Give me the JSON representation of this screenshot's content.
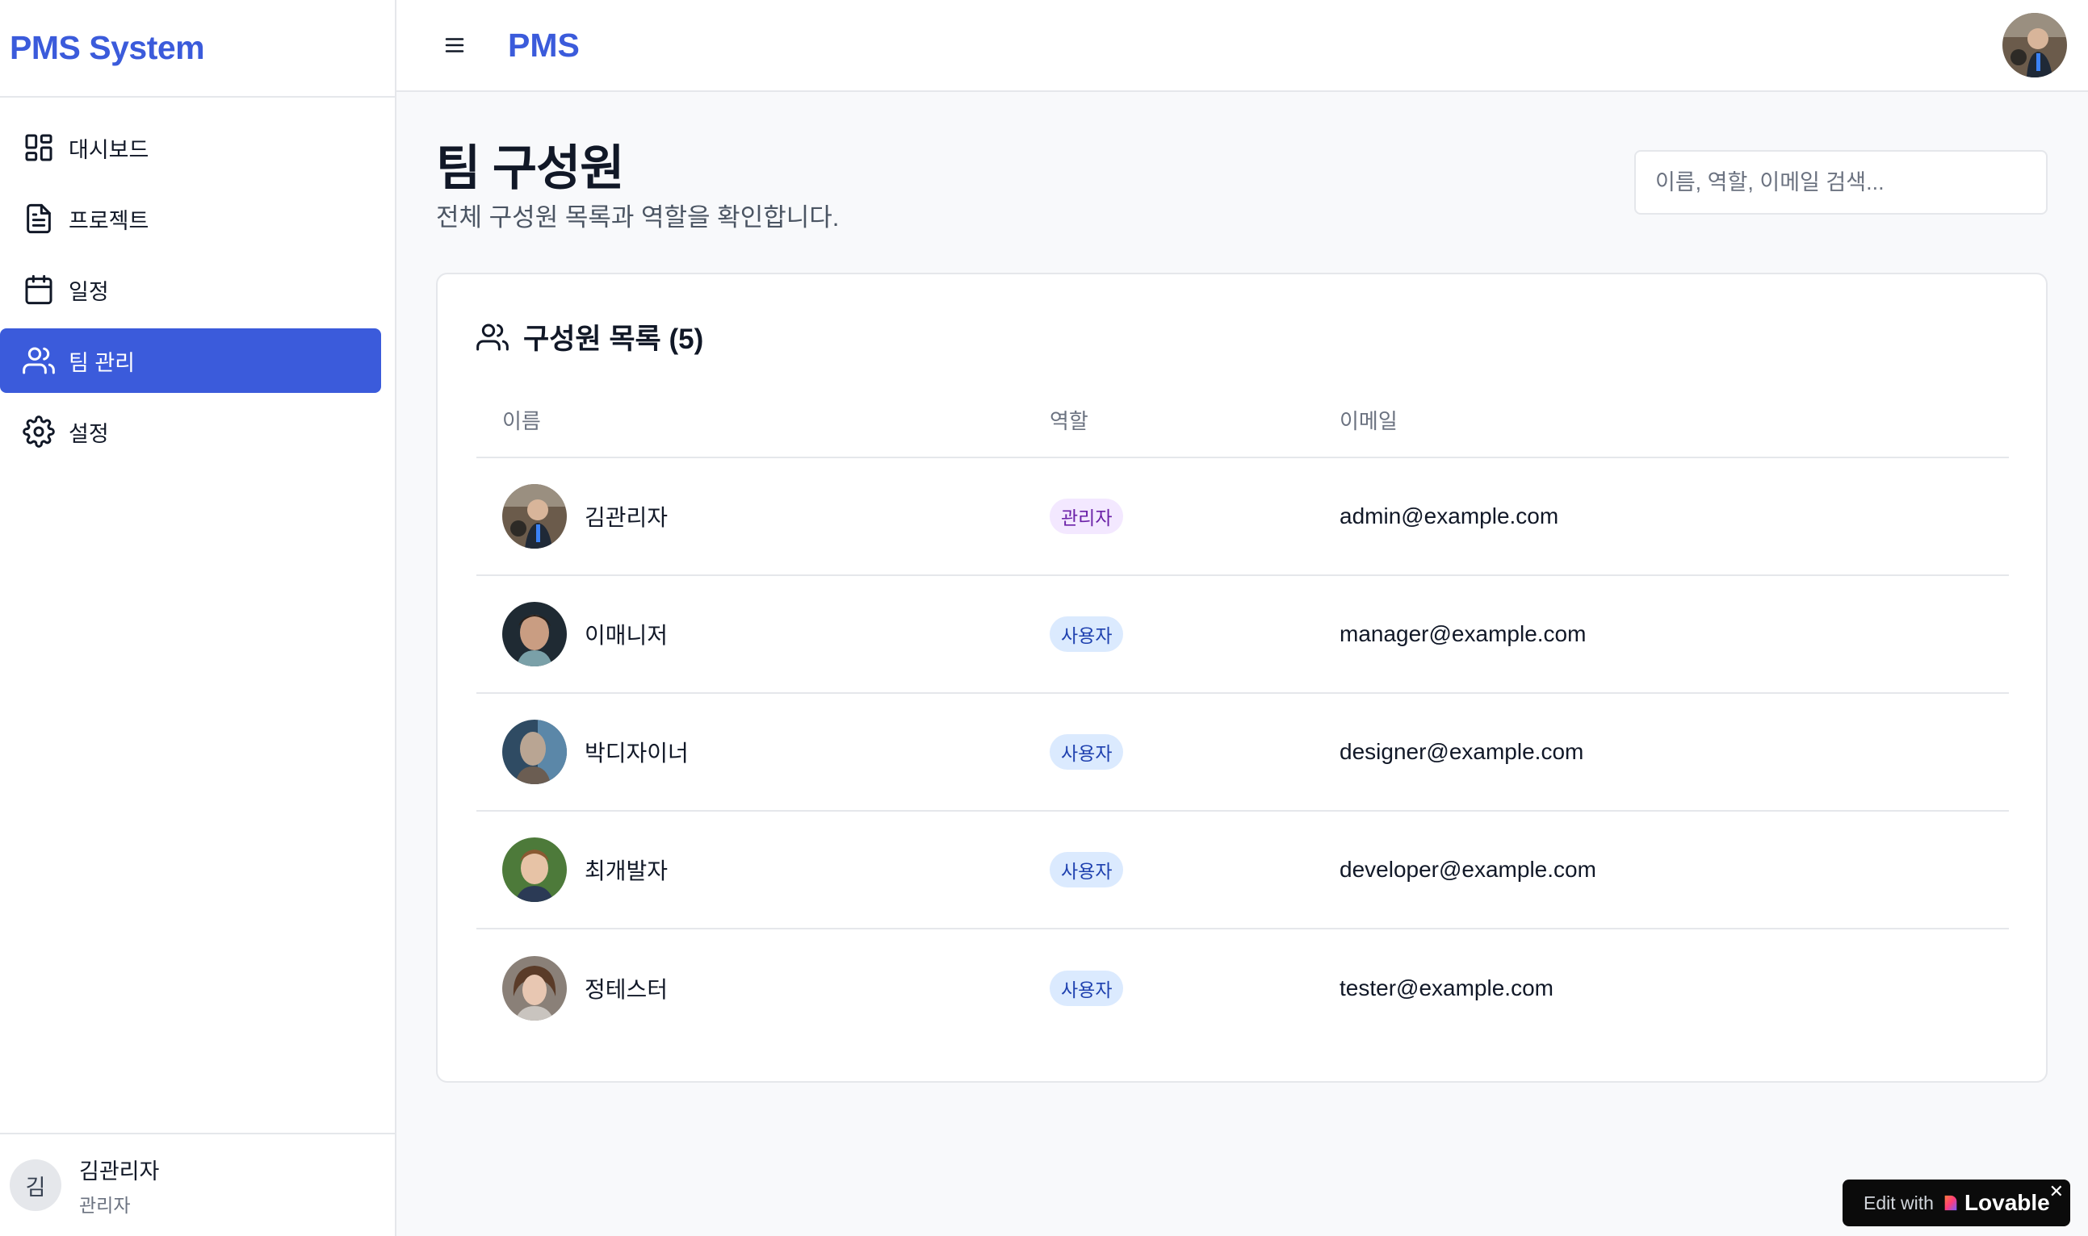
{
  "sidebar": {
    "brand": "PMS System",
    "items": [
      {
        "label": "대시보드",
        "icon": "dashboard-icon"
      },
      {
        "label": "프로젝트",
        "icon": "document-icon"
      },
      {
        "label": "일정",
        "icon": "calendar-icon"
      },
      {
        "label": "팀 관리",
        "icon": "users-icon",
        "active": true
      },
      {
        "label": "설정",
        "icon": "gear-icon"
      }
    ],
    "user": {
      "initial": "김",
      "name": "김관리자",
      "role": "관리자"
    }
  },
  "header": {
    "title": "PMS"
  },
  "page": {
    "title": "팀 구성원",
    "subtitle": "전체 구성원 목록과 역할을 확인합니다.",
    "search_placeholder": "이름, 역할, 이메일 검색..."
  },
  "members_card": {
    "title": "구성원 목록 (5)",
    "columns": {
      "name": "이름",
      "role": "역할",
      "email": "이메일"
    },
    "rows": [
      {
        "name": "김관리자",
        "role": "관리자",
        "email": "admin@example.com"
      },
      {
        "name": "이매니저",
        "role": "사용자",
        "email": "manager@example.com"
      },
      {
        "name": "박디자이너",
        "role": "사용자",
        "email": "designer@example.com"
      },
      {
        "name": "최개발자",
        "role": "사용자",
        "email": "developer@example.com"
      },
      {
        "name": "정테스터",
        "role": "사용자",
        "email": "tester@example.com"
      }
    ]
  },
  "lovable_badge": {
    "prefix": "Edit with",
    "brand": "Lovable",
    "close": "✕"
  },
  "colors": {
    "accent": "#3b5bdb",
    "admin_badge": "#f3e8ff",
    "user_badge": "#dbeafe"
  }
}
